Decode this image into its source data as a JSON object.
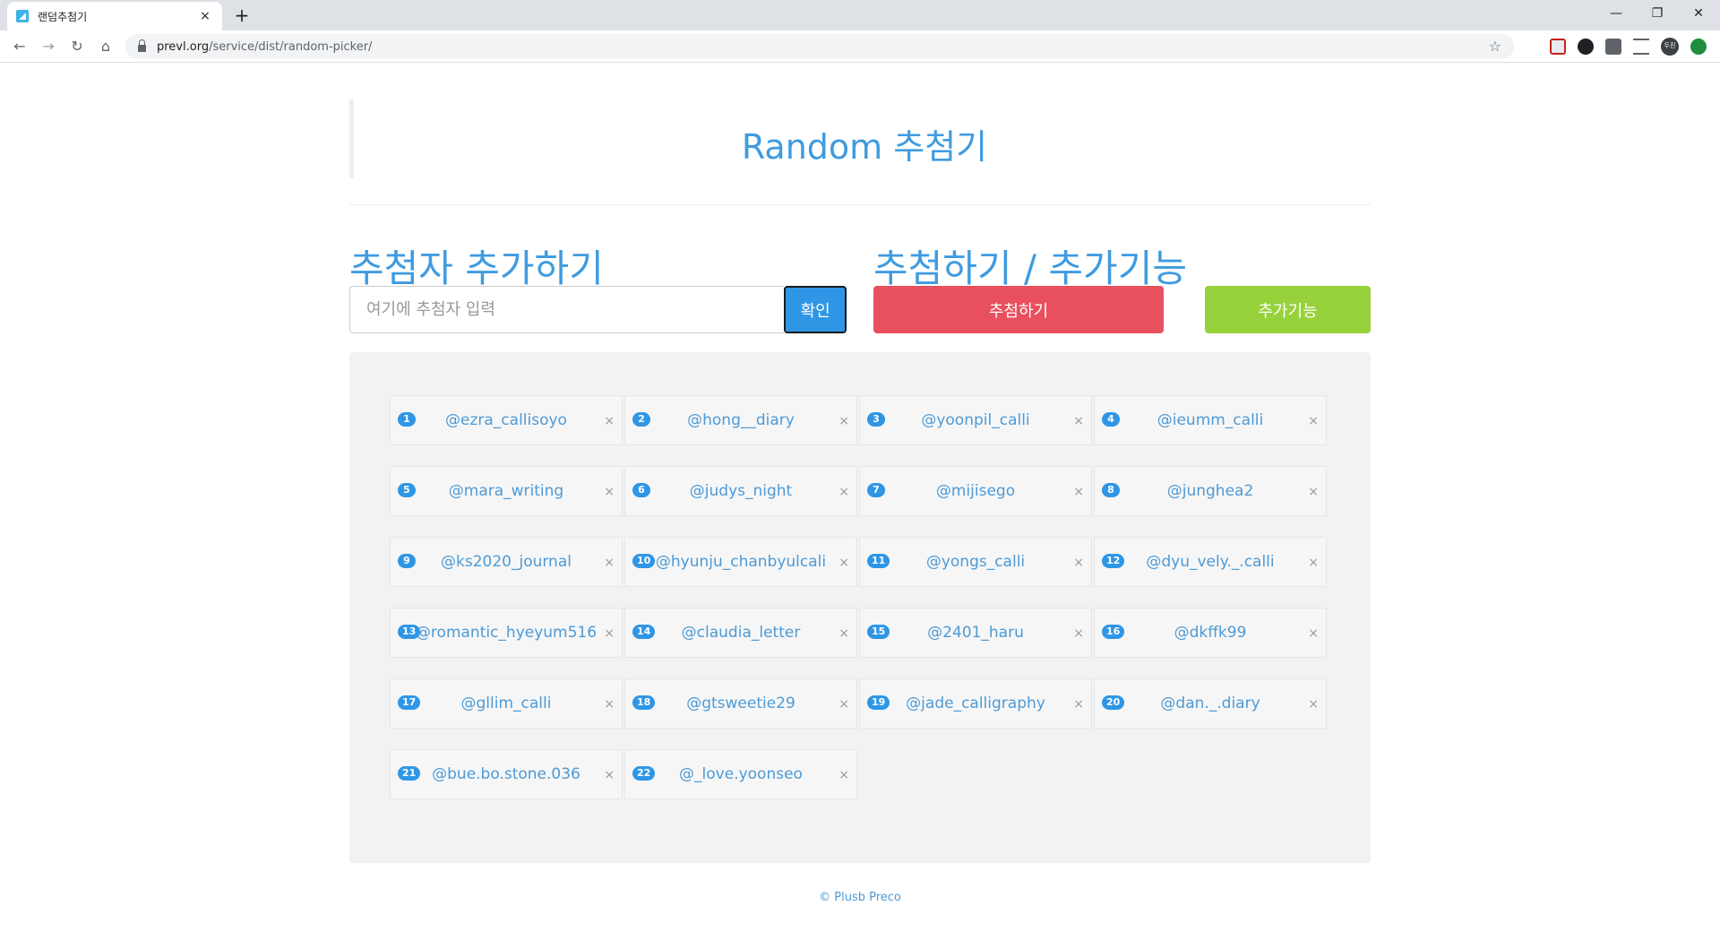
{
  "browser": {
    "tab_title": "랜덤추첨기",
    "tab_close": "×",
    "new_tab": "+",
    "url_host": "prevl.org",
    "url_path": "/service/dist/random-picker/",
    "win_minimize": "—",
    "win_restore": "❐",
    "win_close": "✕",
    "avatar_text": "두진"
  },
  "page": {
    "title": "Random 추첨기",
    "add_section_title": "추첨자 추가하기",
    "draw_section_title": "추첨하기 / 추가기능",
    "input_placeholder": "여기에 추첨자 입력",
    "confirm_label": "확인",
    "draw_label": "추첨하기",
    "extra_label": "추가기능",
    "remove_symbol": "×",
    "footer": "© Plusb Preco"
  },
  "entries": [
    {
      "num": "1",
      "name": "@ezra_callisoyo"
    },
    {
      "num": "2",
      "name": "@hong__diary"
    },
    {
      "num": "3",
      "name": "@yoonpil_calli"
    },
    {
      "num": "4",
      "name": "@ieumm_calli"
    },
    {
      "num": "5",
      "name": "@mara_writing"
    },
    {
      "num": "6",
      "name": "@judys_night"
    },
    {
      "num": "7",
      "name": "@mijisego"
    },
    {
      "num": "8",
      "name": "@junghea2"
    },
    {
      "num": "9",
      "name": "@ks2020_journal"
    },
    {
      "num": "10",
      "name": "@hyunju_chanbyulcali"
    },
    {
      "num": "11",
      "name": "@yongs_calli"
    },
    {
      "num": "12",
      "name": "@dyu_vely._.calli"
    },
    {
      "num": "13",
      "name": "@romantic_hyeyum516"
    },
    {
      "num": "14",
      "name": "@claudia_letter"
    },
    {
      "num": "15",
      "name": "@2401_haru"
    },
    {
      "num": "16",
      "name": "@dkffk99"
    },
    {
      "num": "17",
      "name": "@gllim_calli"
    },
    {
      "num": "18",
      "name": "@gtsweetie29"
    },
    {
      "num": "19",
      "name": "@jade_calligraphy"
    },
    {
      "num": "20",
      "name": "@dan._.diary"
    },
    {
      "num": "21",
      "name": "@bue.bo.stone.036"
    },
    {
      "num": "22",
      "name": "@_love.yoonseo"
    }
  ],
  "colors": {
    "accent_blue": "#3f9be0",
    "draw_red": "#e9505d",
    "extra_green": "#97d23d",
    "badge_blue": "#2f96e6"
  }
}
